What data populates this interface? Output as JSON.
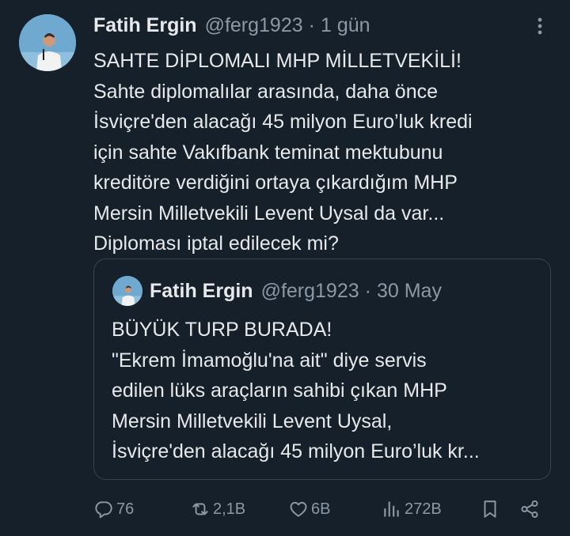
{
  "tweet": {
    "author_name": "Fatih Ergin",
    "handle": "@ferg1923",
    "separator": "·",
    "time": "1 gün",
    "text_lines": [
      "SAHTE DİPLOMALI MHP MİLLETVEKİLİ!",
      "Sahte diplomalılar arasında, daha önce",
      "İsviçre'den alacağı 45 milyon Euro’luk kredi",
      "için sahte Vakıfbank teminat mektubunu",
      "kreditöre verdiğini ortaya çıkardığım MHP",
      "Mersin Milletvekili Levent Uysal da var...",
      "Diploması iptal edilecek mi?"
    ]
  },
  "quote": {
    "author_name": "Fatih Ergin",
    "handle": "@ferg1923",
    "separator": "·",
    "time": "30 May",
    "text_lines": [
      "BÜYÜK TURP BURADA!",
      "\"Ekrem İmamoğlu'na ait\" diye servis",
      "edilen lüks araçların sahibi çıkan MHP",
      "Mersin Milletvekili Levent Uysal,",
      "İsviçre'den alacağı 45 milyon Euro’luk kr..."
    ]
  },
  "actions": {
    "replies": "76",
    "reposts": "2,1B",
    "likes": "6B",
    "views": "272B"
  },
  "icons": {
    "reply": "reply-icon",
    "repost": "repost-icon",
    "like": "heart-icon",
    "views": "views-icon",
    "bookmark": "bookmark-icon",
    "share": "share-icon",
    "more": "more-vertical-icon"
  },
  "colors": {
    "background": "#15202b",
    "text": "#e7e9ea",
    "secondary_text": "#8b98a5",
    "border": "#38444d"
  }
}
